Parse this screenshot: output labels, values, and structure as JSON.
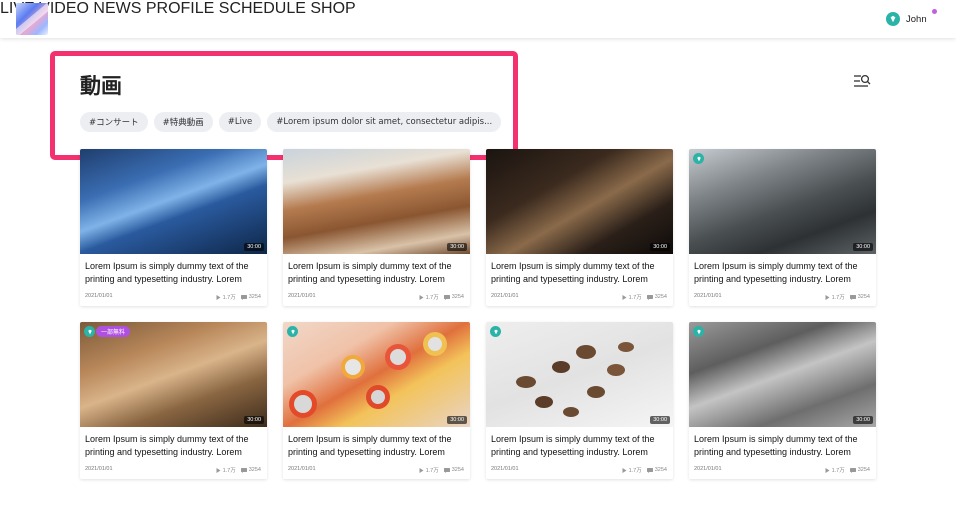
{
  "header": {
    "nav": [
      "LIVE",
      "VIDEO",
      "NEWS",
      "PROFILE",
      "SCHEDULE",
      "SHOP"
    ],
    "user_name": "John"
  },
  "page": {
    "title": "動画",
    "tags": [
      "#コンサート",
      "#特典動画",
      "#Live",
      "#Lorem ipsum dolor sit amet, consectetur adipis..."
    ]
  },
  "colors": {
    "accent": "#f3316e",
    "nav": "#2b2f7a",
    "gem": "#2bb3a8",
    "badge": "#b050e0"
  },
  "cards": [
    {
      "title": "Lorem Ipsum is simply dummy text of the printing and typesetting industry. Lorem",
      "date": "2021/01/01",
      "views": "1.7万",
      "comments": "3254",
      "duration": "30:00",
      "gem": false,
      "badge": ""
    },
    {
      "title": "Lorem Ipsum is simply dummy text of the printing and typesetting industry. Lorem",
      "date": "2021/01/01",
      "views": "1.7万",
      "comments": "3254",
      "duration": "30:00",
      "gem": false,
      "badge": ""
    },
    {
      "title": "Lorem Ipsum is simply dummy text of the printing and typesetting industry. Lorem",
      "date": "2021/01/01",
      "views": "1.7万",
      "comments": "3254",
      "duration": "30:00",
      "gem": false,
      "badge": ""
    },
    {
      "title": "Lorem Ipsum is simply dummy text of the printing and typesetting industry. Lorem",
      "date": "2021/01/01",
      "views": "1.7万",
      "comments": "3254",
      "duration": "30:00",
      "gem": true,
      "badge": ""
    },
    {
      "title": "Lorem Ipsum is simply dummy text of the printing and typesetting industry. Lorem",
      "date": "2021/01/01",
      "views": "1.7万",
      "comments": "3254",
      "duration": "30:00",
      "gem": true,
      "badge": "一部無料"
    },
    {
      "title": "Lorem Ipsum is simply dummy text of the printing and typesetting industry. Lorem",
      "date": "2021/01/01",
      "views": "1.7万",
      "comments": "3254",
      "duration": "30:00",
      "gem": true,
      "badge": ""
    },
    {
      "title": "Lorem Ipsum is simply dummy text of the printing and typesetting industry. Lorem",
      "date": "2021/01/01",
      "views": "1.7万",
      "comments": "3254",
      "duration": "30:00",
      "gem": true,
      "badge": ""
    },
    {
      "title": "Lorem Ipsum is simply dummy text of the printing and typesetting industry. Lorem",
      "date": "2021/01/01",
      "views": "1.7万",
      "comments": "3254",
      "duration": "30:00",
      "gem": true,
      "badge": ""
    }
  ]
}
